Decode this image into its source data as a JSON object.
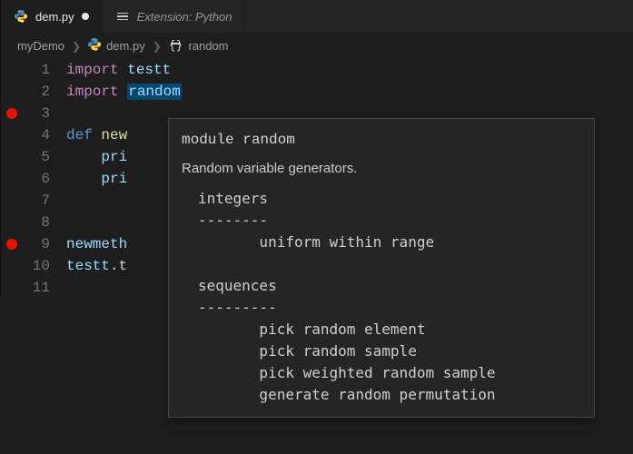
{
  "tabs": [
    {
      "label": "dem.py",
      "active": true,
      "dirty": true,
      "icon": "python"
    },
    {
      "label": "Extension: Python",
      "active": false,
      "italic": true,
      "icon": "list"
    }
  ],
  "breadcrumbs": {
    "items": [
      {
        "label": "myDemo",
        "icon": null
      },
      {
        "label": "dem.py",
        "icon": "python"
      },
      {
        "label": "random",
        "icon": "namespace"
      }
    ]
  },
  "editor": {
    "lines": [
      {
        "n": 1,
        "tokens": [
          [
            "kw",
            "import"
          ],
          [
            "pl",
            " "
          ],
          [
            "id2",
            "testt"
          ]
        ]
      },
      {
        "n": 2,
        "tokens": [
          [
            "kw",
            "import"
          ],
          [
            "pl",
            " "
          ],
          [
            "sel id2",
            "random"
          ]
        ]
      },
      {
        "n": 3,
        "tokens": [],
        "breakpoint": true
      },
      {
        "n": 4,
        "tokens": [
          [
            "fn",
            "def"
          ],
          [
            "pl",
            " "
          ],
          [
            "nm",
            "new"
          ]
        ]
      },
      {
        "n": 5,
        "tokens": [
          [
            "pl",
            "    "
          ],
          [
            "id2",
            "pri"
          ]
        ]
      },
      {
        "n": 6,
        "tokens": [
          [
            "pl",
            "    "
          ],
          [
            "id2",
            "pri"
          ]
        ]
      },
      {
        "n": 7,
        "tokens": []
      },
      {
        "n": 8,
        "tokens": []
      },
      {
        "n": 9,
        "tokens": [
          [
            "id2",
            "newmeth"
          ]
        ],
        "breakpoint": true
      },
      {
        "n": 10,
        "tokens": [
          [
            "id2",
            "testt"
          ],
          [
            "pl",
            ".t"
          ]
        ]
      },
      {
        "n": 11,
        "tokens": []
      }
    ]
  },
  "hover": {
    "signature": "module random",
    "description": "Random variable generators.",
    "body": "integers\n--------\n       uniform within range\n\nsequences\n---------\n       pick random element\n       pick random sample\n       pick weighted random sample\n       generate random permutation"
  }
}
